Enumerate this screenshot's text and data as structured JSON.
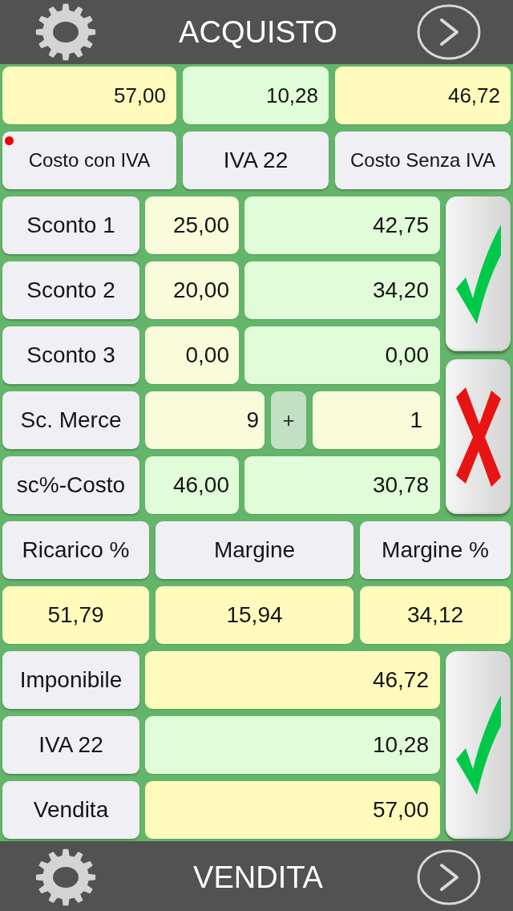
{
  "top_bar": {
    "title": "ACQUISTO"
  },
  "totals": [
    {
      "text": "57,00",
      "kind": "amount"
    },
    {
      "text": "10,28",
      "kind": "computed"
    },
    {
      "text": "46,72",
      "kind": "amount"
    }
  ],
  "modes": [
    {
      "label": "Costo con IVA",
      "selected": true
    },
    {
      "label": "IVA 22",
      "selected": false
    },
    {
      "label": "Costo Senza IVA",
      "selected": false
    }
  ],
  "discounts": [
    {
      "kind": "percent",
      "label": "Sconto 1",
      "value": {
        "text": "25,00",
        "kind": "input"
      },
      "result": {
        "text": "42,75",
        "kind": "computed"
      }
    },
    {
      "kind": "percent",
      "label": "Sconto 2",
      "value": {
        "text": "20,00",
        "kind": "input"
      },
      "result": {
        "text": "34,20",
        "kind": "computed"
      }
    },
    {
      "kind": "percent",
      "label": "Sconto 3",
      "value": {
        "text": "0,00",
        "kind": "input"
      },
      "result": {
        "text": "0,00",
        "kind": "computed"
      }
    },
    {
      "kind": "goods",
      "label": "Sc. Merce",
      "quantity": {
        "text": "9",
        "kind": "input"
      },
      "operator": "+",
      "free": {
        "text": "1",
        "kind": "input"
      }
    },
    {
      "kind": "percent",
      "label": "sc%-Costo",
      "value": {
        "text": "46,00",
        "kind": "computed"
      },
      "result": {
        "text": "30,78",
        "kind": "computed"
      }
    }
  ],
  "margins": {
    "headers": [
      "Ricarico %",
      "Margine",
      "Margine %"
    ],
    "values": [
      {
        "text": "51,79",
        "kind": "amount"
      },
      {
        "text": "15,94",
        "kind": "amount"
      },
      {
        "text": "34,12",
        "kind": "amount"
      }
    ]
  },
  "sale": [
    {
      "label": "Imponibile",
      "value": {
        "text": "46,72",
        "kind": "amount"
      }
    },
    {
      "label": "IVA 22",
      "value": {
        "text": "10,28",
        "kind": "computed"
      }
    },
    {
      "label": "Vendita",
      "value": {
        "text": "57,00",
        "kind": "amount"
      }
    }
  ],
  "bottom_bar": {
    "title": "VENDITA"
  }
}
